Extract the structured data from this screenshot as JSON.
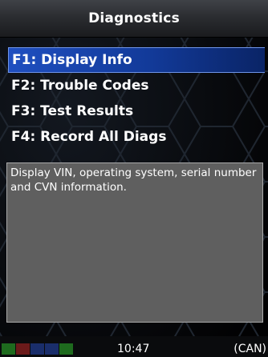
{
  "header": {
    "title": "Diagnostics"
  },
  "menu": {
    "items": [
      {
        "label": "F1: Display Info",
        "selected": true
      },
      {
        "label": "F2: Trouble Codes",
        "selected": false
      },
      {
        "label": "F3: Test Results",
        "selected": false
      },
      {
        "label": "F4: Record All Diags",
        "selected": false
      }
    ]
  },
  "description": {
    "text": "Display VIN, operating system, serial number and CVN information."
  },
  "status_bar": {
    "time": "10:47",
    "protocol": "(CAN)",
    "leds": [
      {
        "color": "#1e6b1e"
      },
      {
        "color": "#6b1a1a"
      },
      {
        "color": "#1a2e6b"
      },
      {
        "color": "#1a2e6b"
      },
      {
        "color": "#1e6b1e"
      }
    ]
  },
  "colors": {
    "selection": "#1f4fc0",
    "description_background": "#5f5f5f",
    "background": "#050608"
  }
}
